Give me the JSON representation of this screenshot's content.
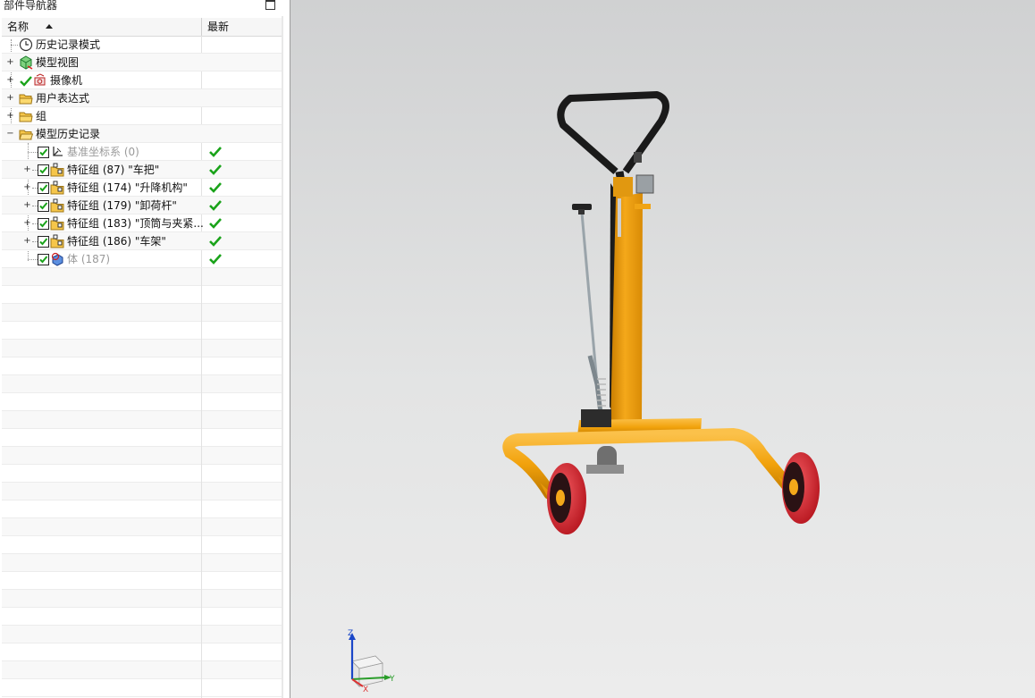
{
  "navigator": {
    "title": "部件导航器",
    "columns": {
      "name": "名称",
      "latest": "最新"
    },
    "tree": [
      {
        "label": "历史记录模式",
        "icon": "clock-icon"
      },
      {
        "label": "模型视图",
        "icon": "model-views-icon"
      },
      {
        "label": "摄像机",
        "icon": "camera-icon"
      },
      {
        "label": "用户表达式",
        "icon": "folder-icon"
      },
      {
        "label": "组",
        "icon": "folder-icon"
      },
      {
        "label": "模型历史记录",
        "icon": "folder-open-icon"
      },
      {
        "label": "基准坐标系 (0)",
        "icon": "datum-csys-icon",
        "checked": true,
        "latest": true
      },
      {
        "label": "特征组 (87) \"车把\"",
        "icon": "feature-group-icon",
        "checked": true,
        "latest": true
      },
      {
        "label": "特征组 (174) \"升降机构\"",
        "icon": "feature-group-icon",
        "checked": true,
        "latest": true
      },
      {
        "label": "特征组 (179) \"卸荷杆\"",
        "icon": "feature-group-icon",
        "checked": true,
        "latest": true
      },
      {
        "label": "特征组 (183) \"顶筒与夹紧...",
        "icon": "feature-group-icon",
        "checked": true,
        "latest": true
      },
      {
        "label": "特征组 (186) \"车架\"",
        "icon": "feature-group-icon",
        "checked": true,
        "latest": true
      },
      {
        "label": "体 (187)",
        "icon": "body-icon",
        "checked": true,
        "latest": true
      }
    ]
  },
  "viewport": {
    "triad": {
      "z": "Z",
      "y": "Y",
      "x": "X"
    },
    "colors": {
      "frame": "#f2a20c",
      "wheel": "#e0323a",
      "handle": "#1a1a1a",
      "rod": "#9aa4aa"
    }
  }
}
